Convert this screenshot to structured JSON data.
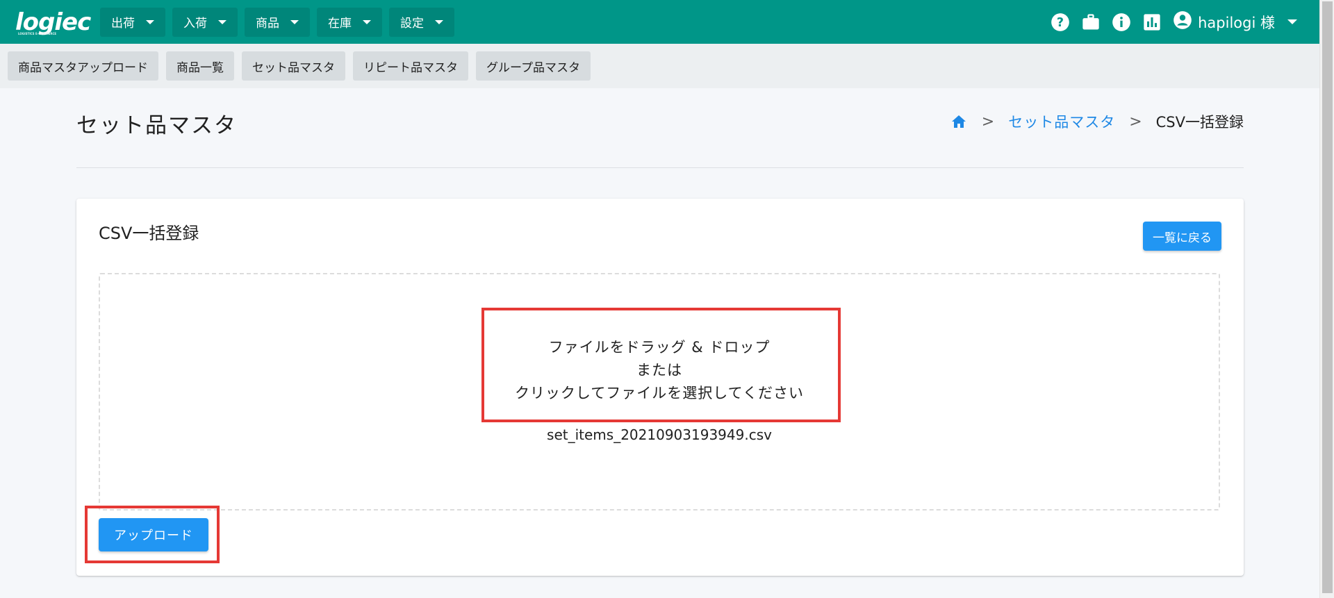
{
  "app": {
    "logo_text": "logiec",
    "logo_sub": "LOGISTICS E-COMMERCE"
  },
  "colors": {
    "topbar": "#009688",
    "subbar": "#eceff1",
    "accent": "#2196f3",
    "highlight": "#e53935",
    "link": "#1e88e5"
  },
  "topnav": {
    "menus": [
      {
        "label": "出荷"
      },
      {
        "label": "入荷"
      },
      {
        "label": "商品"
      },
      {
        "label": "在庫"
      },
      {
        "label": "設定"
      }
    ],
    "icons": [
      "help-icon",
      "briefcase-icon",
      "info-icon",
      "chart-icon"
    ],
    "user": {
      "icon": "account-circle-icon",
      "name": "hapilogi 様"
    }
  },
  "subnav": {
    "items": [
      {
        "label": "商品マスタアップロード"
      },
      {
        "label": "商品一覧"
      },
      {
        "label": "セット品マスタ"
      },
      {
        "label": "リピート品マスタ"
      },
      {
        "label": "グループ品マスタ"
      }
    ]
  },
  "page": {
    "title": "セット品マスタ",
    "breadcrumb": {
      "home_icon": "home-icon",
      "separator": ">",
      "link": "セット品マスタ",
      "current": "CSV一括登録"
    }
  },
  "card": {
    "title": "CSV一括登録",
    "back_label": "一覧に戻る",
    "dropzone": {
      "line1": "ファイルをドラッグ & ドロップ",
      "line2": "または",
      "line3": "クリックしてファイルを選択してください",
      "file_name": "set_items_20210903193949.csv"
    },
    "upload_label": "アップロード"
  }
}
